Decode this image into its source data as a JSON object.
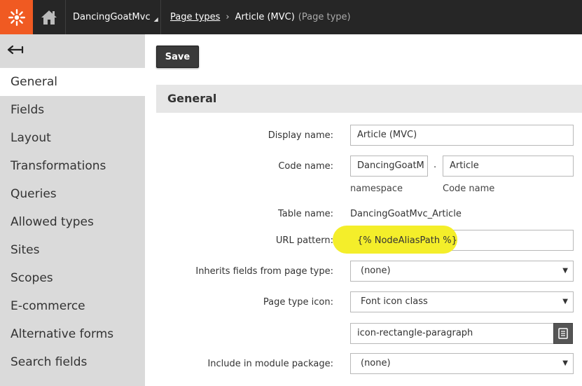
{
  "topbar": {
    "logo_icon": "kentico-logo-icon",
    "home_icon": "home-icon",
    "site_name": "DancingGoatMvc",
    "breadcrumbs": {
      "parent_link": "Page types",
      "current": "Article (MVC)",
      "current_type": "(Page type)"
    }
  },
  "sidebar": {
    "back_icon": "back-arrow-icon",
    "items": [
      {
        "label": "General",
        "active": true
      },
      {
        "label": "Fields"
      },
      {
        "label": "Layout"
      },
      {
        "label": "Transformations"
      },
      {
        "label": "Queries"
      },
      {
        "label": "Allowed types"
      },
      {
        "label": "Sites"
      },
      {
        "label": "Scopes"
      },
      {
        "label": "E-commerce"
      },
      {
        "label": "Alternative forms"
      },
      {
        "label": "Search fields"
      }
    ]
  },
  "toolbar": {
    "save_label": "Save"
  },
  "form": {
    "section_title": "General",
    "display_name": {
      "label": "Display name:",
      "value": "Article (MVC)"
    },
    "code_name": {
      "label": "Code name:",
      "namespace_value": "DancingGoatM",
      "separator": ".",
      "name_value": "Article",
      "namespace_hint": "namespace",
      "name_hint": "Code name"
    },
    "table_name": {
      "label": "Table name:",
      "value": "DancingGoatMvc_Article"
    },
    "url_pattern": {
      "label": "URL pattern:",
      "value": "{% NodeAliasPath %}"
    },
    "inherits": {
      "label": "Inherits fields from page type:",
      "value": "(none)"
    },
    "page_type_icon": {
      "label": "Page type icon:",
      "value": "Font icon class",
      "icon_class_value": "icon-rectangle-paragraph"
    },
    "module_package": {
      "label": "Include in module package:",
      "value": "(none)"
    }
  },
  "colors": {
    "topbar": "#262626",
    "logo_bg": "#f05a22",
    "sidebar": "#dadada",
    "highlight": "#f4ee2a",
    "save_button": "#3a3a3a"
  }
}
